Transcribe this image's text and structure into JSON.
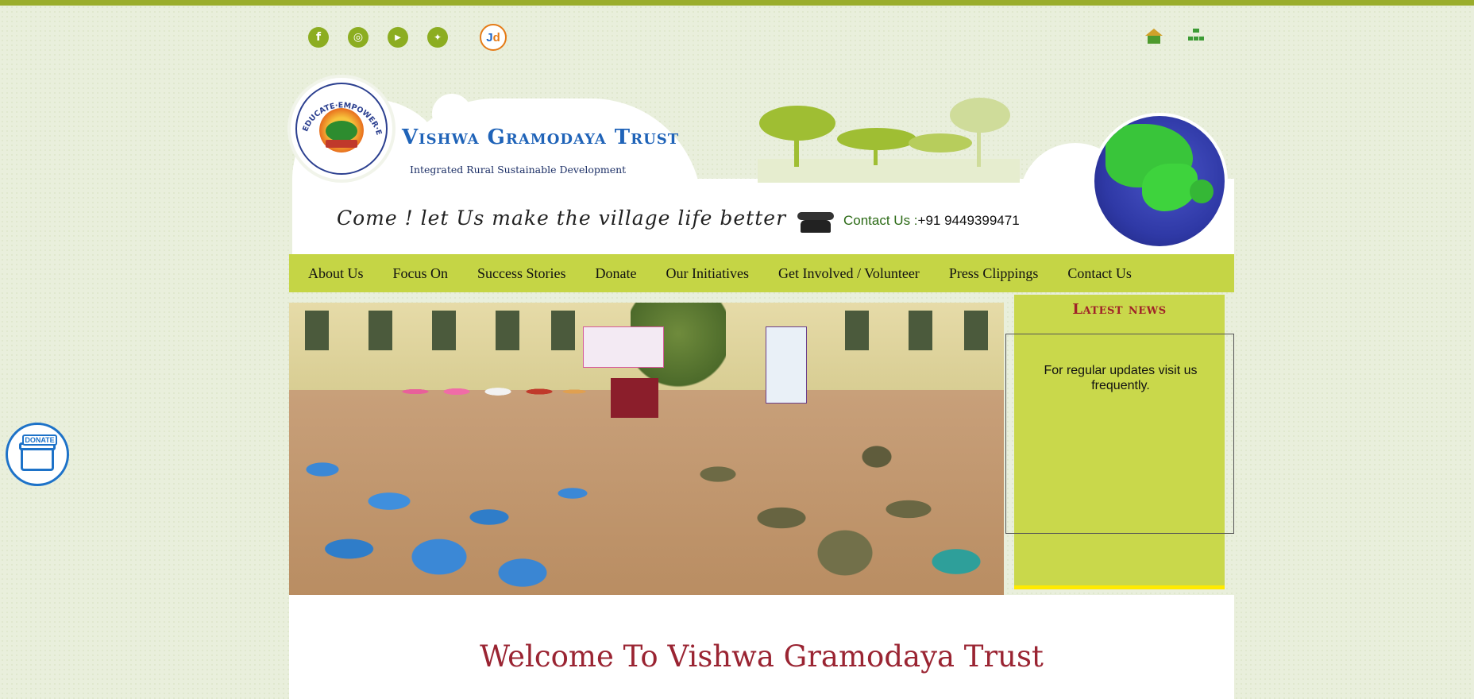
{
  "social": {
    "icons": [
      "facebook-icon",
      "instagram-icon",
      "youtube-icon",
      "twitter-icon",
      "justdial-icon"
    ],
    "facebook_glyph": "f",
    "instagram_glyph": "◎",
    "youtube_glyph": "▶",
    "twitter_glyph": "✦",
    "justdial_glyph_j": "J",
    "justdial_glyph_d": "d"
  },
  "header": {
    "logo_text": "EDUCATE·EMPOWER·ELEVATE",
    "title": "Vishwa Gramodaya Trust",
    "subtitle": "Integrated Rural Sustainable Development",
    "tagline": "Come ! let Us make the village life better",
    "contact_label": "Contact Us :",
    "contact_phone": "+91 9449399471"
  },
  "nav": {
    "items": [
      {
        "label": "About Us"
      },
      {
        "label": "Focus On"
      },
      {
        "label": "Success Stories"
      },
      {
        "label": "Donate"
      },
      {
        "label": "Our Initiatives"
      },
      {
        "label": "Get Involved / Volunteer"
      },
      {
        "label": "Press Clippings"
      },
      {
        "label": "Contact Us"
      }
    ]
  },
  "news": {
    "title": "Latest news",
    "text": "For regular updates visit us frequently."
  },
  "content": {
    "welcome": "Welcome To Vishwa Gramodaya Trust"
  },
  "donate_float": {
    "label": "DONATE"
  },
  "colors": {
    "accent_green": "#c5d545",
    "top_bar": "#9aad2c",
    "title_blue": "#1f63b8",
    "heading_red": "#9a2432",
    "news_yellow": "#ffea00"
  }
}
